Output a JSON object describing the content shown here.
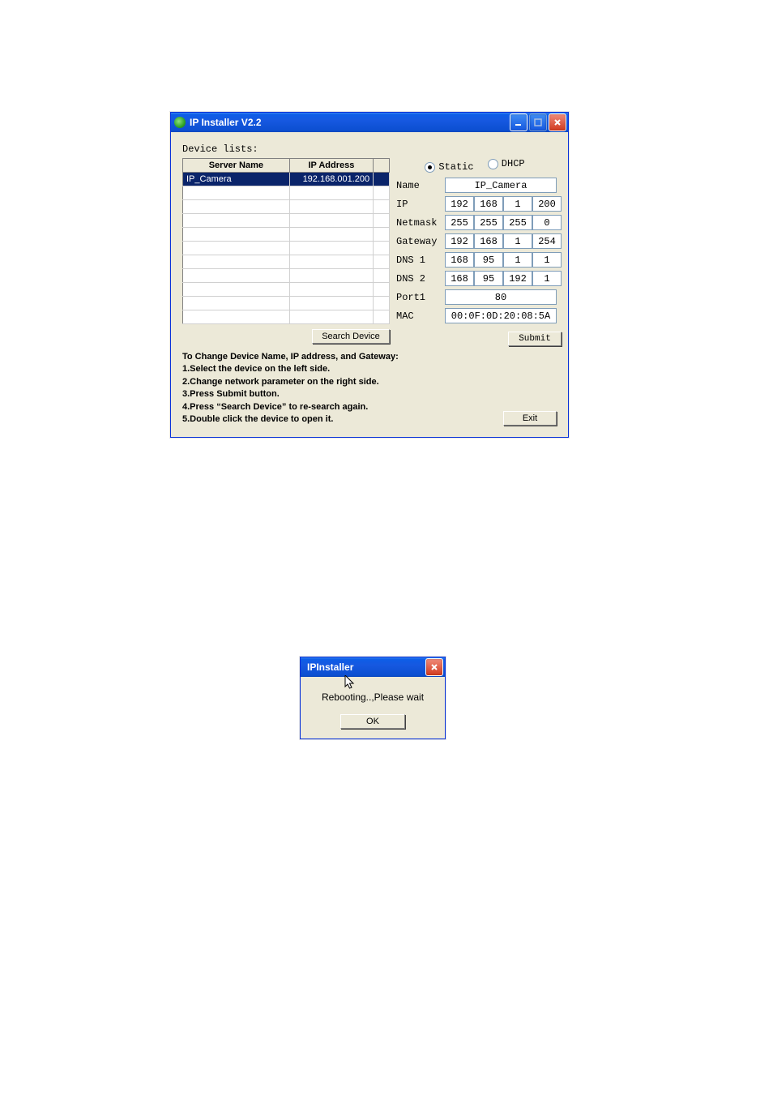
{
  "window1": {
    "title": "IP Installer V2.2",
    "device_lists_label": "Device lists:",
    "table": {
      "headers": {
        "server_name": "Server Name",
        "ip_address": "IP Address"
      },
      "rows": [
        {
          "server_name": "IP_Camera",
          "ip_address": "192.168.001.200"
        }
      ]
    },
    "search_device_label": "Search Device",
    "radios": {
      "static": "Static",
      "dhcp": "DHCP"
    },
    "form": {
      "name": {
        "label": "Name",
        "value": "IP_Camera"
      },
      "ip": {
        "label": "IP",
        "o1": "192",
        "o2": "168",
        "o3": "1",
        "o4": "200"
      },
      "netmask": {
        "label": "Netmask",
        "o1": "255",
        "o2": "255",
        "o3": "255",
        "o4": "0"
      },
      "gateway": {
        "label": "Gateway",
        "o1": "192",
        "o2": "168",
        "o3": "1",
        "o4": "254"
      },
      "dns1": {
        "label": "DNS 1",
        "o1": "168",
        "o2": "95",
        "o3": "1",
        "o4": "1"
      },
      "dns2": {
        "label": "DNS 2",
        "o1": "168",
        "o2": "95",
        "o3": "192",
        "o4": "1"
      },
      "port1": {
        "label": "Port1",
        "value": "80"
      },
      "mac": {
        "label": "MAC",
        "value": "00:0F:0D:20:08:5A"
      }
    },
    "submit_label": "Submit",
    "exit_label": "Exit",
    "instructions": {
      "heading": "To Change Device Name, IP address, and Gateway:",
      "l1": "1.Select the device on the left side.",
      "l2": "2.Change network parameter on the right side.",
      "l3": "3.Press Submit button.",
      "l4": "4.Press “Search Device” to re-search again.",
      "l5": "5.Double click the device to open it."
    }
  },
  "window2": {
    "title": "IPInstaller",
    "message": "Rebooting..,Please wait",
    "ok_label": "OK"
  }
}
